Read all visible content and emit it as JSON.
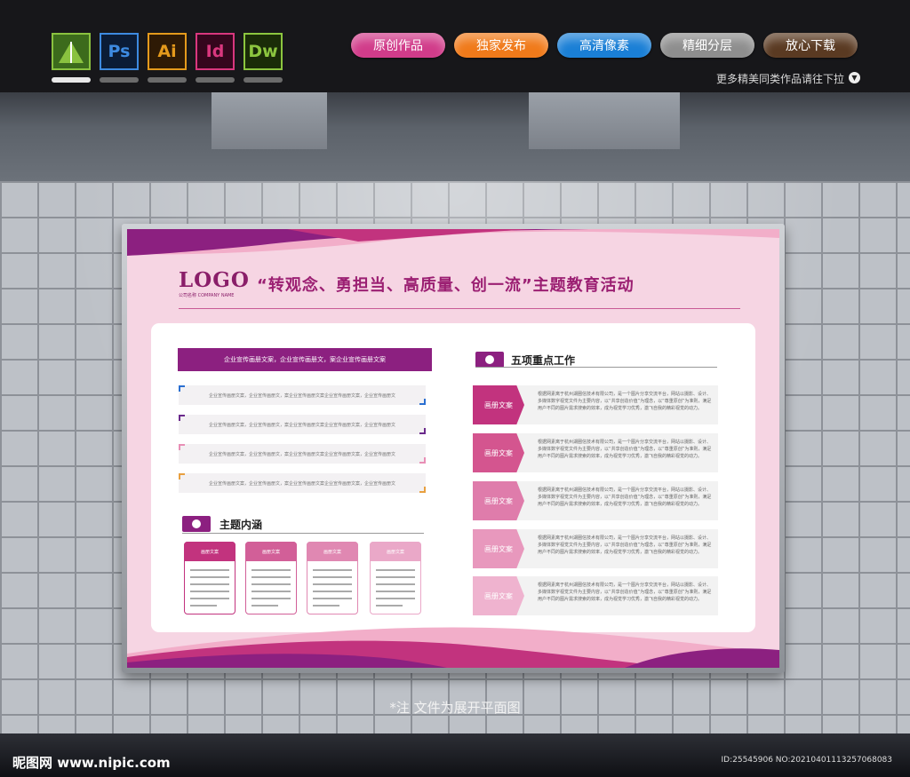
{
  "top_bar": {
    "app_icons": [
      {
        "label": "",
        "icon": "coreldraw-icon",
        "color": "#8ac23f"
      },
      {
        "label": "Ps",
        "icon": "photoshop-icon",
        "color": "#3d8ae0"
      },
      {
        "label": "Ai",
        "icon": "illustrator-icon",
        "color": "#e49a1c"
      },
      {
        "label": "Id",
        "icon": "indesign-icon",
        "color": "#d9377e"
      },
      {
        "label": "Dw",
        "icon": "dreamweaver-icon",
        "color": "#8cc63f"
      }
    ],
    "pills": [
      {
        "label": "原创作品",
        "color": "#d13c8a"
      },
      {
        "label": "独家发布",
        "color": "#f07a1a"
      },
      {
        "label": "高清像素",
        "color": "#1a7fd6"
      },
      {
        "label": "精细分层",
        "color": "#8e8e8e"
      },
      {
        "label": "放心下载",
        "color": "#5a3a22"
      }
    ],
    "more_hint": "更多精美同类作品请往下拉"
  },
  "board": {
    "logo": "LOGO",
    "logo_sub": "公司名称 COMPANY NAME",
    "title": "“转观念、勇担当、高质量、创一流”主题教育活动",
    "left_banner": "企业宣传画册文案，企业宣传画册文，案企业宣传画册文案",
    "left_items": [
      {
        "text": "企业宣传画册文案，企业宣传画册文，案企业宣传画册文案企业宣传画册文案，企业宣传画册文",
        "accent": "#2a6fd1"
      },
      {
        "text": "企业宣传画册文案，企业宣传画册文，案企业宣传画册文案企业宣传画册文案，企业宣传画册文",
        "accent": "#6b2a8c"
      },
      {
        "text": "企业宣传画册文案，企业宣传画册文，案企业宣传画册文案企业宣传画册文案，企业宣传画册文",
        "accent": "#e88fb6"
      },
      {
        "text": "企业宣传画册文案，企业宣传画册文，案企业宣传画册文案企业宣传画册文案，企业宣传画册文",
        "accent": "#e8a040"
      }
    ],
    "section_left": "主题内涵",
    "cards": [
      {
        "label": "画册文案",
        "color": "#c2337e"
      },
      {
        "label": "画册文案",
        "color": "#d25f98"
      },
      {
        "label": "画册文案",
        "color": "#e088b2"
      },
      {
        "label": "画册文案",
        "color": "#eaa8c8"
      }
    ],
    "section_right": "五项重点工作",
    "work_items": [
      {
        "tag": "画册文案",
        "color": "#c2337e",
        "text": "根据网素离于杭州湖圈信技术有限公司，是一个图片分享交流平台，网站以摄影、设计、多媒体数字视觉文件为主要内容，以“共享创造价值”为理念，以“尊重原创”为准则，满足用户不同的图片需求搜索的效率，成为视觉学习优秀，激飞自我的精彩视觉的动力。"
      },
      {
        "tag": "画册文案",
        "color": "#d4558f",
        "text": "根据网素离于杭州湖圈信技术有限公司，是一个图片分享交流平台，网站以摄影、设计、多媒体数字视觉文件为主要内容，以“共享创造价值”为理念，以“尊重原创”为准则，满足用户不同的图片需求搜索的效率，成为视觉学习优秀，激飞自我的精彩视觉的动力。"
      },
      {
        "tag": "画册文案",
        "color": "#df7cab",
        "text": "根据网素离于杭州湖圈信技术有限公司，是一个图片分享交流平台，网站以摄影、设计、多媒体数字视觉文件为主要内容，以“共享创造价值”为理念，以“尊重原创”为准则，满足用户不同的图片需求搜索的效率，成为视觉学习优秀，激飞自我的精彩视觉的动力。"
      },
      {
        "tag": "画册文案",
        "color": "#e898bd",
        "text": "根据网素离于杭州湖圈信技术有限公司，是一个图片分享交流平台，网站以摄影、设计、多媒体数字视觉文件为主要内容，以“共享创造价值”为理念，以“尊重原创”为准则，满足用户不同的图片需求搜索的效率，成为视觉学习优秀，激飞自我的精彩视觉的动力。"
      },
      {
        "tag": "画册文案",
        "color": "#efb3cf",
        "text": "根据网素离于杭州湖圈信技术有限公司，是一个图片分享交流平台，网站以摄影、设计、多媒体数字视觉文件为主要内容，以“共享创造价值”为理念，以“尊重原创”为准则，满足用户不同的图片需求搜索的效率，成为视觉学习优秀，激飞自我的精彩视觉的动力。"
      }
    ]
  },
  "note": "*注  文件为展开平面图",
  "watermark": {
    "site": "昵图网 www.nipic.com",
    "id_line": "ID:25545906 NO:20210401113257068083"
  }
}
